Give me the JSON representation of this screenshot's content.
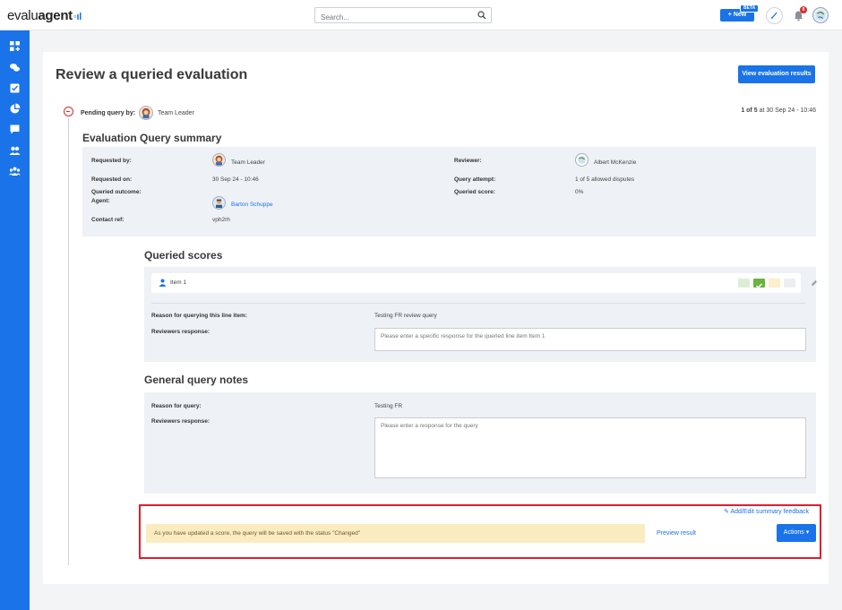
{
  "header": {
    "logo_part1": "evalu",
    "logo_part2": "agent",
    "search_placeholder": "Search...",
    "new_button": "+ New",
    "beta_badge": "BETA",
    "notification_count": "8"
  },
  "page": {
    "title": "Review a queried evaluation",
    "view_results_button": "View evaluation results"
  },
  "pending": {
    "label": "Pending query by:",
    "role": "Team Leader",
    "counter": "1 of 5",
    "date_prefix": "at 30 Sep 24 - 10:46"
  },
  "summary": {
    "title": "Evaluation Query summary",
    "requested_by_label": "Requested by:",
    "requested_by_value": "Team Leader",
    "requested_on_label": "Requested on:",
    "requested_on_value": "30 Sep 24 - 10:46",
    "queried_outcome_label": "Queried outcome:",
    "agent_label": "Agent:",
    "agent_value": "Barton Schuppe",
    "contact_ref_label": "Contact ref:",
    "contact_ref_value": "vph2rh",
    "reviewer_label": "Reviewer:",
    "reviewer_value": "Albert McKenzie",
    "query_attempt_label": "Query attempt:",
    "query_attempt_value": "1 of 5 allowed disputes",
    "queried_score_label": "Queried score:",
    "queried_score_value": "0%"
  },
  "queried_scores": {
    "title": "Queried scores",
    "item_label": "Item 1",
    "reason_label": "Reason for querying this line item:",
    "reason_value": "Testing FR review query",
    "response_label": "Reviewers response:",
    "response_placeholder": "Please enter a specific response for the queried line item Item 1"
  },
  "general_notes": {
    "title": "General query notes",
    "reason_label": "Reason for query:",
    "reason_value": "Testing FR",
    "response_label": "Reviewers response:",
    "response_placeholder": "Please enter a response for the query"
  },
  "actions": {
    "feedback_link": "Add/Edit summary feedback",
    "warning": "As you have updated a score, the query will be saved with the status \"Changed\"",
    "preview_link": "Preview result",
    "actions_button": "Actions"
  },
  "colors": {
    "primary": "#1a73e8",
    "warning_bg": "#fbecc0",
    "highlight": "#e11d2e",
    "pass_chip": "#6db33f"
  }
}
